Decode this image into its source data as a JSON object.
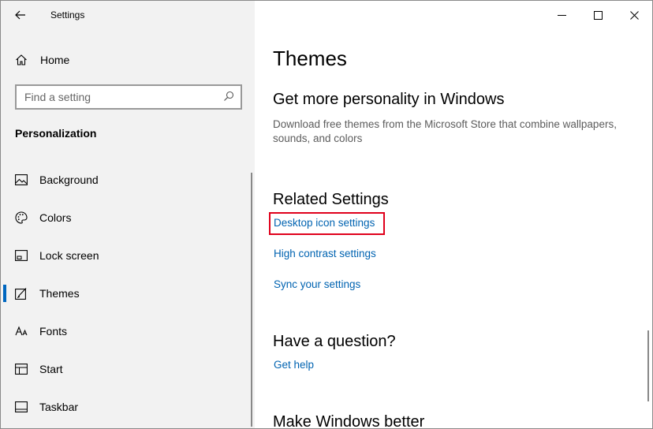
{
  "window": {
    "title": "Settings"
  },
  "sidebar": {
    "home_label": "Home",
    "search_placeholder": "Find a setting",
    "section_title": "Personalization",
    "items": [
      {
        "label": "Background",
        "icon": "image-icon"
      },
      {
        "label": "Colors",
        "icon": "palette-icon"
      },
      {
        "label": "Lock screen",
        "icon": "lock-screen-icon"
      },
      {
        "label": "Themes",
        "icon": "themes-icon",
        "active": true
      },
      {
        "label": "Fonts",
        "icon": "fonts-icon"
      },
      {
        "label": "Start",
        "icon": "start-icon"
      },
      {
        "label": "Taskbar",
        "icon": "taskbar-icon"
      }
    ]
  },
  "content": {
    "page_title": "Themes",
    "personality_heading": "Get more personality in Windows",
    "personality_desc": "Download free themes from the Microsoft Store that combine wallpapers, sounds, and colors",
    "related_heading": "Related Settings",
    "related_links": [
      "Desktop icon settings",
      "High contrast settings",
      "Sync your settings"
    ],
    "question_heading": "Have a question?",
    "help_link": "Get help",
    "better_heading": "Make Windows better"
  },
  "colors": {
    "accent": "#0067c0",
    "link": "#0063b1",
    "highlight": "#e0001b"
  }
}
